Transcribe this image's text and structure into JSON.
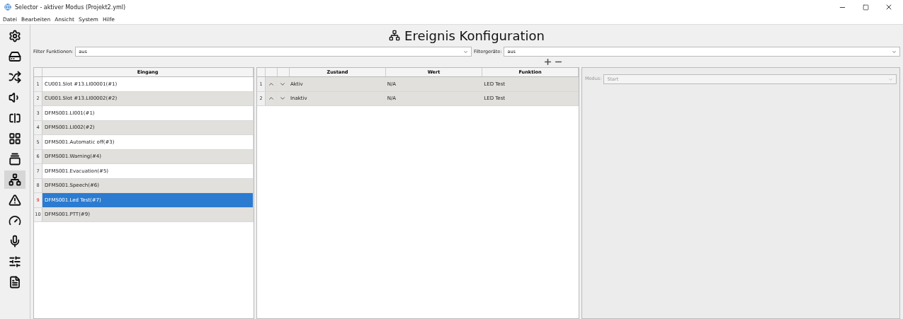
{
  "window": {
    "title": "Selector - aktiver Modus (Projekt2.yml)"
  },
  "menu": [
    "Datei",
    "Bearbeiten",
    "Ansicht",
    "System",
    "Hilfe"
  ],
  "sidebar": {
    "items": [
      {
        "selected": false
      },
      {
        "selected": false
      },
      {
        "selected": false
      },
      {
        "selected": false
      },
      {
        "selected": false
      },
      {
        "selected": false
      },
      {
        "selected": false
      },
      {
        "selected": true
      },
      {
        "selected": false
      },
      {
        "selected": false
      },
      {
        "selected": false
      },
      {
        "selected": false
      },
      {
        "selected": false
      }
    ]
  },
  "heading": "Ereignis Konfiguration",
  "filters": [
    {
      "label": "Filter Funktionen:",
      "value": "aus"
    },
    {
      "label": "Filtergeräte:",
      "value": "aus"
    }
  ],
  "inputs_table": {
    "column": "Eingang",
    "rows": [
      {
        "number": "1",
        "name": "CU001.Slot #13.LI00001(#1)",
        "selected": false
      },
      {
        "number": "2",
        "name": "CU001.Slot #13.LI00002(#2)",
        "selected": false
      },
      {
        "number": "3",
        "name": "DFMS001.LI001(#1)",
        "selected": false
      },
      {
        "number": "4",
        "name": "DFMS001.LI002(#2)",
        "selected": false
      },
      {
        "number": "5",
        "name": "DFMS001.Automatic off(#3)",
        "selected": false
      },
      {
        "number": "6",
        "name": "DFMS001.Warning(#4)",
        "selected": false
      },
      {
        "number": "7",
        "name": "DFMS001.Evacuation(#5)",
        "selected": false
      },
      {
        "number": "8",
        "name": "DFMS001.Speech(#6)",
        "selected": false
      },
      {
        "number": "9",
        "name": "DFMS001.Led Test(#7)",
        "selected": true
      },
      {
        "number": "10",
        "name": "DFMS001.PTT(#9)",
        "selected": false
      }
    ]
  },
  "events_table": {
    "columns": [
      "Zustand",
      "Wert",
      "Funktion"
    ],
    "rows": [
      {
        "number": "1",
        "state": "Aktiv",
        "value": "N/A",
        "function": "LED Test"
      },
      {
        "number": "2",
        "state": "Inaktiv",
        "value": "N/A",
        "function": "LED Test"
      }
    ]
  },
  "detail": {
    "label": "Modus:",
    "value": "Start",
    "disabled": true
  }
}
